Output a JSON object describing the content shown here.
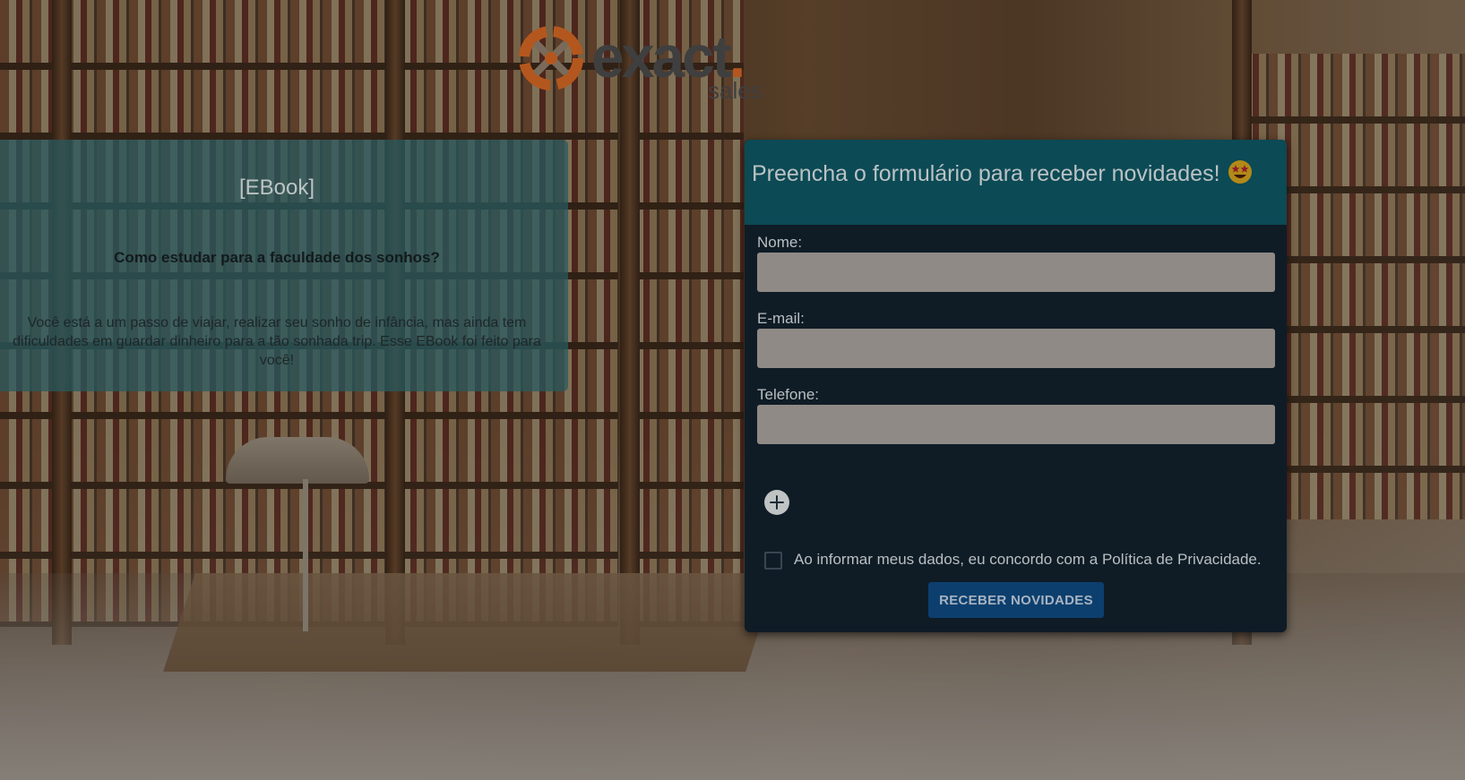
{
  "logo": {
    "word": "exact",
    "dot": ".",
    "sub": "sales",
    "accent_color": "#b4571e"
  },
  "ebook": {
    "title": "[EBook]",
    "subtitle": "Como estudar para a faculdade dos sonhos?",
    "description": "Você está a um passo de viajar, realizar seu sonho de infância, mas ainda tem dificuldades em guardar dinheiro para a tão sonhada trip. Esse EBook foi feito para você!"
  },
  "form": {
    "title": "Preencha o formulário para receber novidades!",
    "title_icon": "star-struck-emoji-icon",
    "fields": [
      {
        "label": "Nome:",
        "value": "",
        "placeholder": ""
      },
      {
        "label": "E-mail:",
        "value": "",
        "placeholder": ""
      },
      {
        "label": "Telefone:",
        "value": "",
        "placeholder": ""
      }
    ],
    "add_icon": "plus-circle-icon",
    "consent_text": "Ao informar meus dados, eu concordo com a Política de Privacidade.",
    "consent_checked": false,
    "submit_label": "RECEBER NOVIDADES",
    "colors": {
      "header": "#0c4a55",
      "body": "#0f1c26",
      "button": "#0c3f6e"
    }
  }
}
